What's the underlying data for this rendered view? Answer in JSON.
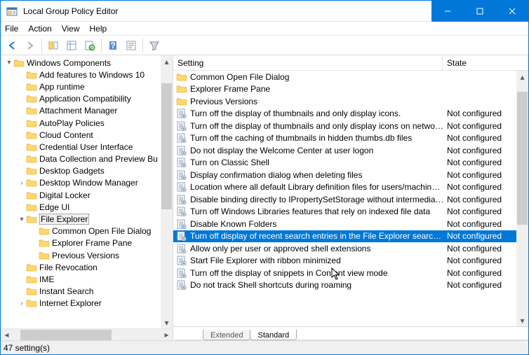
{
  "window": {
    "title": "Local Group Policy Editor"
  },
  "menubar": [
    "File",
    "Action",
    "View",
    "Help"
  ],
  "tree": {
    "root": {
      "label": "Windows Components",
      "depth": 0,
      "exp": "▾"
    },
    "items": [
      {
        "label": "Add features to Windows 10",
        "depth": 1,
        "exp": ""
      },
      {
        "label": "App runtime",
        "depth": 1,
        "exp": ""
      },
      {
        "label": "Application Compatibility",
        "depth": 1,
        "exp": ""
      },
      {
        "label": "Attachment Manager",
        "depth": 1,
        "exp": ""
      },
      {
        "label": "AutoPlay Policies",
        "depth": 1,
        "exp": ""
      },
      {
        "label": "Cloud Content",
        "depth": 1,
        "exp": ""
      },
      {
        "label": "Credential User Interface",
        "depth": 1,
        "exp": ""
      },
      {
        "label": "Data Collection and Preview Bu",
        "depth": 1,
        "exp": ""
      },
      {
        "label": "Desktop Gadgets",
        "depth": 1,
        "exp": ""
      },
      {
        "label": "Desktop Window Manager",
        "depth": 1,
        "exp": "›"
      },
      {
        "label": "Digital Locker",
        "depth": 1,
        "exp": ""
      },
      {
        "label": "Edge UI",
        "depth": 1,
        "exp": ""
      },
      {
        "label": "File Explorer",
        "depth": 1,
        "exp": "▾",
        "selected": true
      },
      {
        "label": "Common Open File Dialog",
        "depth": 2,
        "exp": ""
      },
      {
        "label": "Explorer Frame Pane",
        "depth": 2,
        "exp": ""
      },
      {
        "label": "Previous Versions",
        "depth": 2,
        "exp": ""
      },
      {
        "label": "File Revocation",
        "depth": 1,
        "exp": ""
      },
      {
        "label": "IME",
        "depth": 1,
        "exp": ""
      },
      {
        "label": "Instant Search",
        "depth": 1,
        "exp": ""
      },
      {
        "label": "Internet Explorer",
        "depth": 1,
        "exp": "›"
      }
    ]
  },
  "list": {
    "cols": {
      "setting": "Setting",
      "state": "State"
    },
    "rows": [
      {
        "type": "folder",
        "label": "Common Open File Dialog",
        "state": ""
      },
      {
        "type": "folder",
        "label": "Explorer Frame Pane",
        "state": ""
      },
      {
        "type": "folder",
        "label": "Previous Versions",
        "state": ""
      },
      {
        "type": "policy",
        "label": "Turn off the display of thumbnails and only display icons.",
        "state": "Not configured"
      },
      {
        "type": "policy",
        "label": "Turn off the display of thumbnails and only display icons on network ...",
        "state": "Not configured"
      },
      {
        "type": "policy",
        "label": "Turn off the caching of thumbnails in hidden thumbs.db files",
        "state": "Not configured"
      },
      {
        "type": "policy",
        "label": "Do not display the Welcome Center at user logon",
        "state": "Not configured"
      },
      {
        "type": "policy",
        "label": "Turn on Classic Shell",
        "state": "Not configured"
      },
      {
        "type": "policy",
        "label": "Display confirmation dialog when deleting files",
        "state": "Not configured"
      },
      {
        "type": "policy",
        "label": "Location where all default Library definition files for users/machines r...",
        "state": "Not configured"
      },
      {
        "type": "policy",
        "label": "Disable binding directly to IPropertySetStorage without intermediate l...",
        "state": "Not configured"
      },
      {
        "type": "policy",
        "label": "Turn off Windows Libraries features that rely on indexed file data",
        "state": "Not configured"
      },
      {
        "type": "policy",
        "label": "Disable Known Folders",
        "state": "Not configured"
      },
      {
        "type": "policy",
        "label": "Turn off display of recent search entries in the File Explorer search box",
        "state": "Not configured",
        "selected": true
      },
      {
        "type": "policy",
        "label": "Allow only per user or approved shell extensions",
        "state": "Not configured"
      },
      {
        "type": "policy",
        "label": "Start File Explorer with ribbon minimized",
        "state": "Not configured"
      },
      {
        "type": "policy",
        "label": "Turn off the display of snippets in Content view mode",
        "state": "Not configured"
      },
      {
        "type": "policy",
        "label": "Do not track Shell shortcuts during roaming",
        "state": "Not configured"
      }
    ]
  },
  "tabs": {
    "extended": "Extended",
    "standard": "Standard"
  },
  "status": "47 setting(s)"
}
